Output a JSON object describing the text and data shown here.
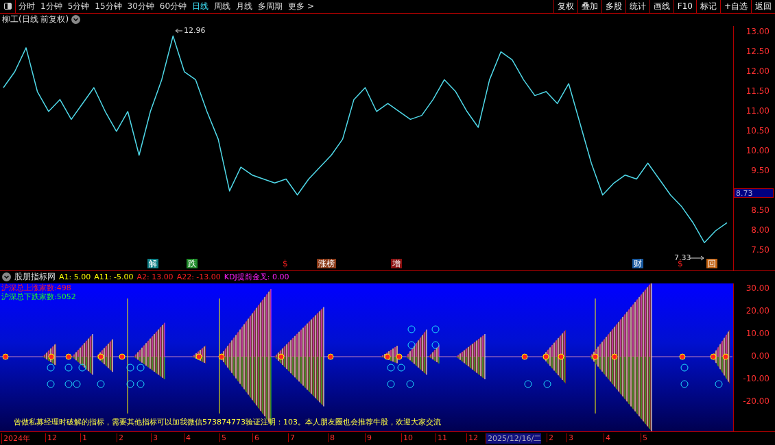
{
  "toolbar": {
    "periods": [
      {
        "label": "分时",
        "selected": false
      },
      {
        "label": "1分钟",
        "selected": false
      },
      {
        "label": "5分钟",
        "selected": false
      },
      {
        "label": "15分钟",
        "selected": false
      },
      {
        "label": "30分钟",
        "selected": false
      },
      {
        "label": "60分钟",
        "selected": false
      },
      {
        "label": "日线",
        "selected": true
      },
      {
        "label": "周线",
        "selected": false
      },
      {
        "label": "月线",
        "selected": false
      },
      {
        "label": "多周期",
        "selected": false
      },
      {
        "label": "更多 >",
        "selected": false
      }
    ],
    "buttons": [
      "复权",
      "叠加",
      "多股",
      "统计",
      "画线",
      "F10",
      "标记",
      "+自选",
      "返回"
    ]
  },
  "price_panel": {
    "title": "柳工(日线 前复权)",
    "current_price": "8.73",
    "high_label": "12.96",
    "low_label": "7.33",
    "markers": [
      {
        "text": "解",
        "kind": "tag",
        "color": "#0e7f86"
      },
      {
        "text": "跌",
        "kind": "tag",
        "color": "#1f8a2a"
      },
      {
        "text": "$",
        "kind": "symbol",
        "color": "#ff2020"
      },
      {
        "text": "涨榜",
        "kind": "tag",
        "color": "#8a3a18"
      },
      {
        "text": "增",
        "kind": "tag",
        "color": "#8a1010"
      },
      {
        "text": "财",
        "kind": "tag",
        "color": "#1a5aa0"
      },
      {
        "text": "$",
        "kind": "symbol",
        "color": "#ff2020"
      },
      {
        "text": "回",
        "kind": "tag",
        "color": "#c06010"
      }
    ],
    "chart_data": {
      "type": "line",
      "ylim": [
        7.0,
        13.15
      ],
      "yticks": [
        {
          "value": 13,
          "label": "13.00"
        },
        {
          "value": 12.5,
          "label": "12.50"
        },
        {
          "value": 12,
          "label": "12.00"
        },
        {
          "value": 11.5,
          "label": "11.50"
        },
        {
          "value": 11,
          "label": "11.00"
        },
        {
          "value": 10.5,
          "label": "10.50"
        },
        {
          "value": 10,
          "label": "10.00"
        },
        {
          "value": 9.5,
          "label": "9.50"
        },
        {
          "value": 8.5,
          "label": "8.50"
        },
        {
          "value": 8,
          "label": "8.00"
        },
        {
          "value": 7.5,
          "label": "7.50"
        }
      ],
      "series": [
        {
          "color": "#4fd8e8",
          "values": [
            11.6,
            12.0,
            12.6,
            11.5,
            11.0,
            11.3,
            10.8,
            11.2,
            11.6,
            11.0,
            10.5,
            11.0,
            9.9,
            11.0,
            11.8,
            12.9,
            12.0,
            11.8,
            11.0,
            10.3,
            9.0,
            9.6,
            9.4,
            9.3,
            9.2,
            9.3,
            8.9,
            9.3,
            9.6,
            9.9,
            10.3,
            11.3,
            11.6,
            11.0,
            11.2,
            11.0,
            10.8,
            10.9,
            11.3,
            11.8,
            11.5,
            11.0,
            10.6,
            11.8,
            12.5,
            12.3,
            11.8,
            11.4,
            11.5,
            11.2,
            11.7,
            10.7,
            9.7,
            8.9,
            9.2,
            9.4,
            9.3,
            9.7,
            9.3,
            8.9,
            8.6,
            8.2,
            7.7,
            8.0,
            8.2
          ]
        }
      ]
    }
  },
  "indicator_panel": {
    "title": "股朋指标网",
    "params": [
      {
        "text": "A1: 5.00",
        "color": "#ffff00"
      },
      {
        "text": "A11: -5.00",
        "color": "#ffff00"
      },
      {
        "text": "A2: 13.00",
        "color": "#ff2020"
      },
      {
        "text": "A22: -13.00",
        "color": "#ff2020"
      },
      {
        "text": "KDJ提前金叉: 0.00",
        "color": "#ff20ff"
      }
    ],
    "stats": [
      {
        "text": "沪深总上涨家数:498",
        "color": "#ff2020"
      },
      {
        "text": "沪深总下跌家数:5052",
        "color": "#20ff20"
      }
    ],
    "axis": [
      "30.00",
      "20.00",
      "10.00",
      "0.00",
      "-10.00",
      "-20.00"
    ],
    "note": "曾做私募经理时破解的指标，需要其他指标可以加我微信573874773验证注明：103。本人朋友圈也会推荐牛股，欢迎大家交流"
  },
  "date_axis": [
    {
      "label": "2024年",
      "selected": false
    },
    {
      "label": "12",
      "selected": false
    },
    {
      "label": "1",
      "selected": false
    },
    {
      "label": "2",
      "selected": false
    },
    {
      "label": "3",
      "selected": false
    },
    {
      "label": "4",
      "selected": false
    },
    {
      "label": "5",
      "selected": false
    },
    {
      "label": "6",
      "selected": false
    },
    {
      "label": "7",
      "selected": false
    },
    {
      "label": "8",
      "selected": false
    },
    {
      "label": "9",
      "selected": false
    },
    {
      "label": "10",
      "selected": false
    },
    {
      "label": "11",
      "selected": false
    },
    {
      "label": "12",
      "selected": false
    },
    {
      "label": "2025/12/16/二",
      "selected": true
    },
    {
      "label": "2",
      "selected": false
    },
    {
      "label": "3",
      "selected": false
    },
    {
      "label": "4",
      "selected": false
    },
    {
      "label": "5",
      "selected": false
    }
  ]
}
